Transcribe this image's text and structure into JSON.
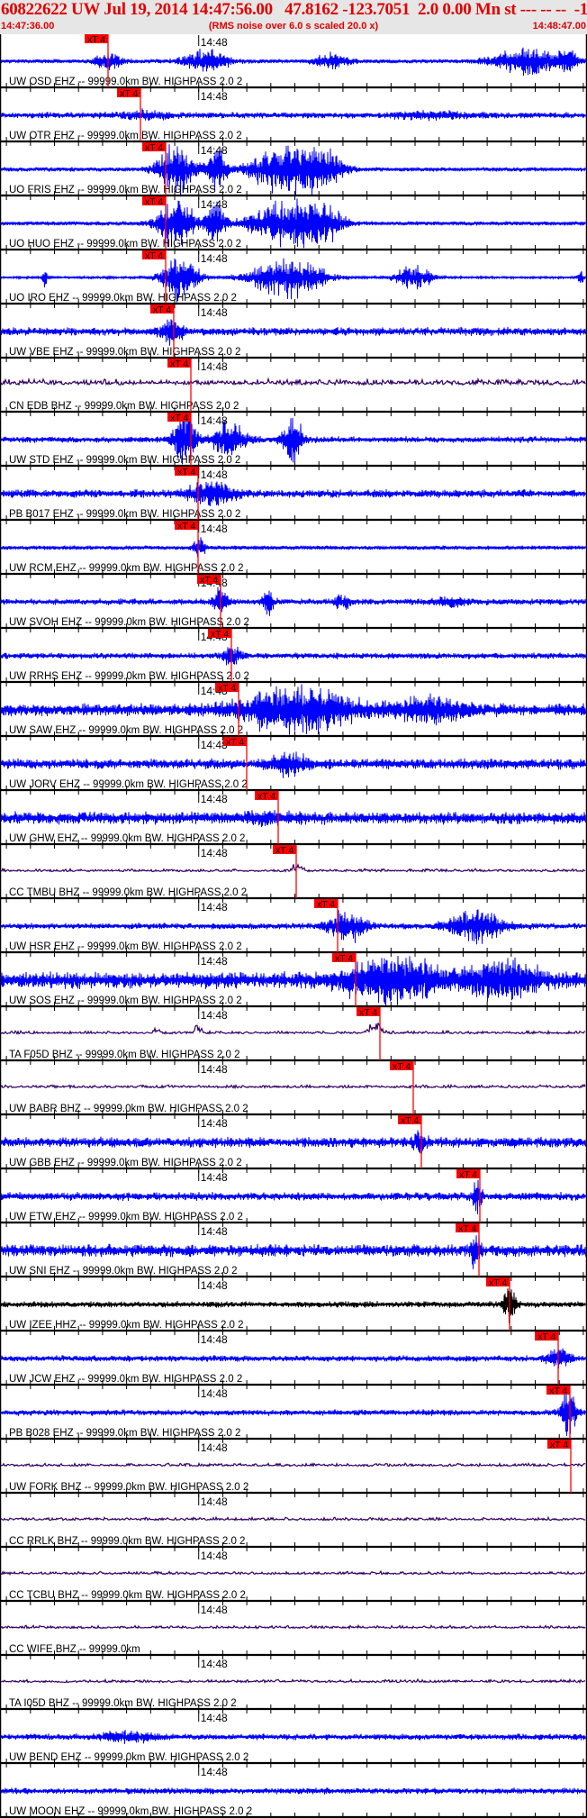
{
  "header": {
    "title": "60822622 UW Jul 19, 2014 14:47:56.00   47.8162 -123.7051  2.0 0.00 Mn st --- -- --  -1",
    "start_time": "14:47:36.00",
    "scaling_note": "(RMS noise over 6.0 s scaled 20.0 x)",
    "end_time": "14:48:47.00"
  },
  "minute_label": "14:48",
  "colors": {
    "header_text": "#e00000",
    "pick": "#ff0000",
    "short_period": "#0000ff",
    "broadband": "#330066",
    "hhz": "#000000"
  },
  "window_seconds": 71,
  "minute_offset_s": 24,
  "traces": [
    {
      "label": "UW OSD EHZ -- 99999.0km BW. HIGHPASS  2.0  2",
      "kind": "short_period",
      "pick": {
        "label": "xT 4",
        "time_s": 13.0
      }
    },
    {
      "label": "UW OTR EHZ -- 99999.0km BW. HIGHPASS  2.0  2",
      "kind": "short_period",
      "pick": {
        "label": "xT 4",
        "time_s": 16.9
      }
    },
    {
      "label": "UO FRIS EHZ -- 99999.0km BW. HIGHPASS  2.0  2",
      "kind": "short_period",
      "pick": {
        "label": "xT 4",
        "time_s": 20.0
      }
    },
    {
      "label": "UO HUO EHZ -- 99999.0km BW. HIGHPASS  2.0  2",
      "kind": "short_period",
      "pick": {
        "label": "xT 4",
        "time_s": 20.0
      }
    },
    {
      "label": "UO IRO EHZ -- 99999.0km BW. HIGHPASS  2.0  2",
      "kind": "short_period",
      "pick": {
        "label": "xT 4",
        "time_s": 20.0
      }
    },
    {
      "label": "UW VBE EHZ -- 99999.0km BW. HIGHPASS  2.0  2",
      "kind": "short_period",
      "pick": {
        "label": "xT 4",
        "time_s": 21.0
      }
    },
    {
      "label": "CN EDB BHZ -- 99999.0km BW. HIGHPASS  2.0  2",
      "kind": "broadband",
      "pick": {
        "label": "xT 4",
        "time_s": 23.0
      }
    },
    {
      "label": "UW STD EHZ -- 99999.0km BW. HIGHPASS  2.0  2",
      "kind": "short_period",
      "pick": {
        "label": "xT 4",
        "time_s": 23.0
      }
    },
    {
      "label": "PB B017 EHZ -- 99999.0km BW. HIGHPASS  2.0  2",
      "kind": "short_period",
      "pick": {
        "label": "xT 4",
        "time_s": 23.9
      }
    },
    {
      "label": "UW RCM EHZ -- 99999.0km BW. HIGHPASS  2.0  2",
      "kind": "short_period",
      "pick": {
        "label": "xT 4",
        "time_s": 23.9
      }
    },
    {
      "label": "UW SVOH EHZ -- 99999.0km BW. HIGHPASS  2.0  2",
      "kind": "short_period",
      "pick": {
        "label": "xT 4",
        "time_s": 26.6
      }
    },
    {
      "label": "UW RRHS EHZ -- 99999.0km BW. HIGHPASS  2.0  2",
      "kind": "short_period",
      "pick": {
        "label": "xT 4",
        "time_s": 28.0
      }
    },
    {
      "label": "UW SAW EHZ -- 99999.0km BW. HIGHPASS  2.0  2",
      "kind": "short_period",
      "pick": {
        "label": "xT 4",
        "time_s": 28.8
      }
    },
    {
      "label": "UW JORV EHZ -- 99999.0km BW. HIGHPASS  2.0  2",
      "kind": "short_period",
      "pick": {
        "label": "xT 4",
        "time_s": 29.8
      }
    },
    {
      "label": "UW GHW EHZ -- 99999.0km BW. HIGHPASS  2.0  2",
      "kind": "short_period",
      "pick": {
        "label": "xT 4",
        "time_s": 33.6
      }
    },
    {
      "label": "CC TMBU BHZ -- 99999.0km BW. HIGHPASS  2.0  2",
      "kind": "broadband",
      "pick": {
        "label": "xT 4",
        "time_s": 35.8
      }
    },
    {
      "label": "UW HSR EHZ -- 99999.0km BW. HIGHPASS  2.0  2",
      "kind": "short_period",
      "pick": {
        "label": "xT 4",
        "time_s": 40.8
      }
    },
    {
      "label": "UW SOS EHZ -- 99999.0km BW. HIGHPASS  2.0  2",
      "kind": "short_period",
      "pick": {
        "label": "xT 4",
        "time_s": 43.0
      }
    },
    {
      "label": "TA F05D BHZ -- 99999.0km BW. HIGHPASS  2.0  2",
      "kind": "broadband",
      "pick": {
        "label": "xT 4",
        "time_s": 46.0
      }
    },
    {
      "label": "UW BABR BHZ -- 99999.0km BW. HIGHPASS  2.0  2",
      "kind": "broadband",
      "pick": {
        "label": "xT 4",
        "time_s": 50.0
      }
    },
    {
      "label": "UW GBB EHZ -- 99999.0km BW. HIGHPASS  2.0  2",
      "kind": "short_period",
      "pick": {
        "label": "xT 4",
        "time_s": 51.0
      }
    },
    {
      "label": "UW ETW EHZ -- 99999.0km BW. HIGHPASS  2.0  2",
      "kind": "short_period",
      "pick": {
        "label": "xT 4",
        "time_s": 58.1
      }
    },
    {
      "label": "UW SNI EHZ -- 99999.0km BW. HIGHPASS  2.0  2",
      "kind": "short_period",
      "pick": {
        "label": "xT 4",
        "time_s": 58.0
      }
    },
    {
      "label": "UW IZEE HHZ -- 99999.0km BW. HIGHPASS  2.0  2",
      "kind": "hhz",
      "pick": {
        "label": "xT 4",
        "time_s": 61.7
      }
    },
    {
      "label": "UW JCW EHZ -- 99999.0km BW. HIGHPASS  2.0  2",
      "kind": "short_period",
      "pick": {
        "label": "xT 4",
        "time_s": 67.6
      }
    },
    {
      "label": "PB B028 EHZ -- 99999.0km BW. HIGHPASS  2.0  2",
      "kind": "short_period",
      "pick": {
        "label": "xT 4",
        "time_s": 69.0
      }
    },
    {
      "label": "UW FORK BHZ -- 99999.0km BW. HIGHPASS  2.0  2",
      "kind": "broadband",
      "pick": {
        "label": "xT 4",
        "time_s": 69.1
      }
    },
    {
      "label": "CC RRLK BHZ -- 99999.0km BW. HIGHPASS  2.0  2",
      "kind": "broadband",
      "pick": null
    },
    {
      "label": "CC TCBU BHZ -- 99999.0km BW. HIGHPASS  2.0  2",
      "kind": "broadband",
      "pick": null
    },
    {
      "label": "CC WIFE BHZ -- 99999.0km",
      "kind": "broadband",
      "pick": null
    },
    {
      "label": "TA I05D BHZ -- 99999.0km BW. HIGHPASS  2.0  2",
      "kind": "broadband",
      "pick": null
    },
    {
      "label": "UW BEND EHZ -- 99999.0km BW. HIGHPASS  2.0  2",
      "kind": "short_period",
      "pick": null
    },
    {
      "label": "UW MOON EHZ -- 99999.0km BW. HIGHPASS  2.0  2",
      "kind": "short_period",
      "pick": null
    }
  ]
}
